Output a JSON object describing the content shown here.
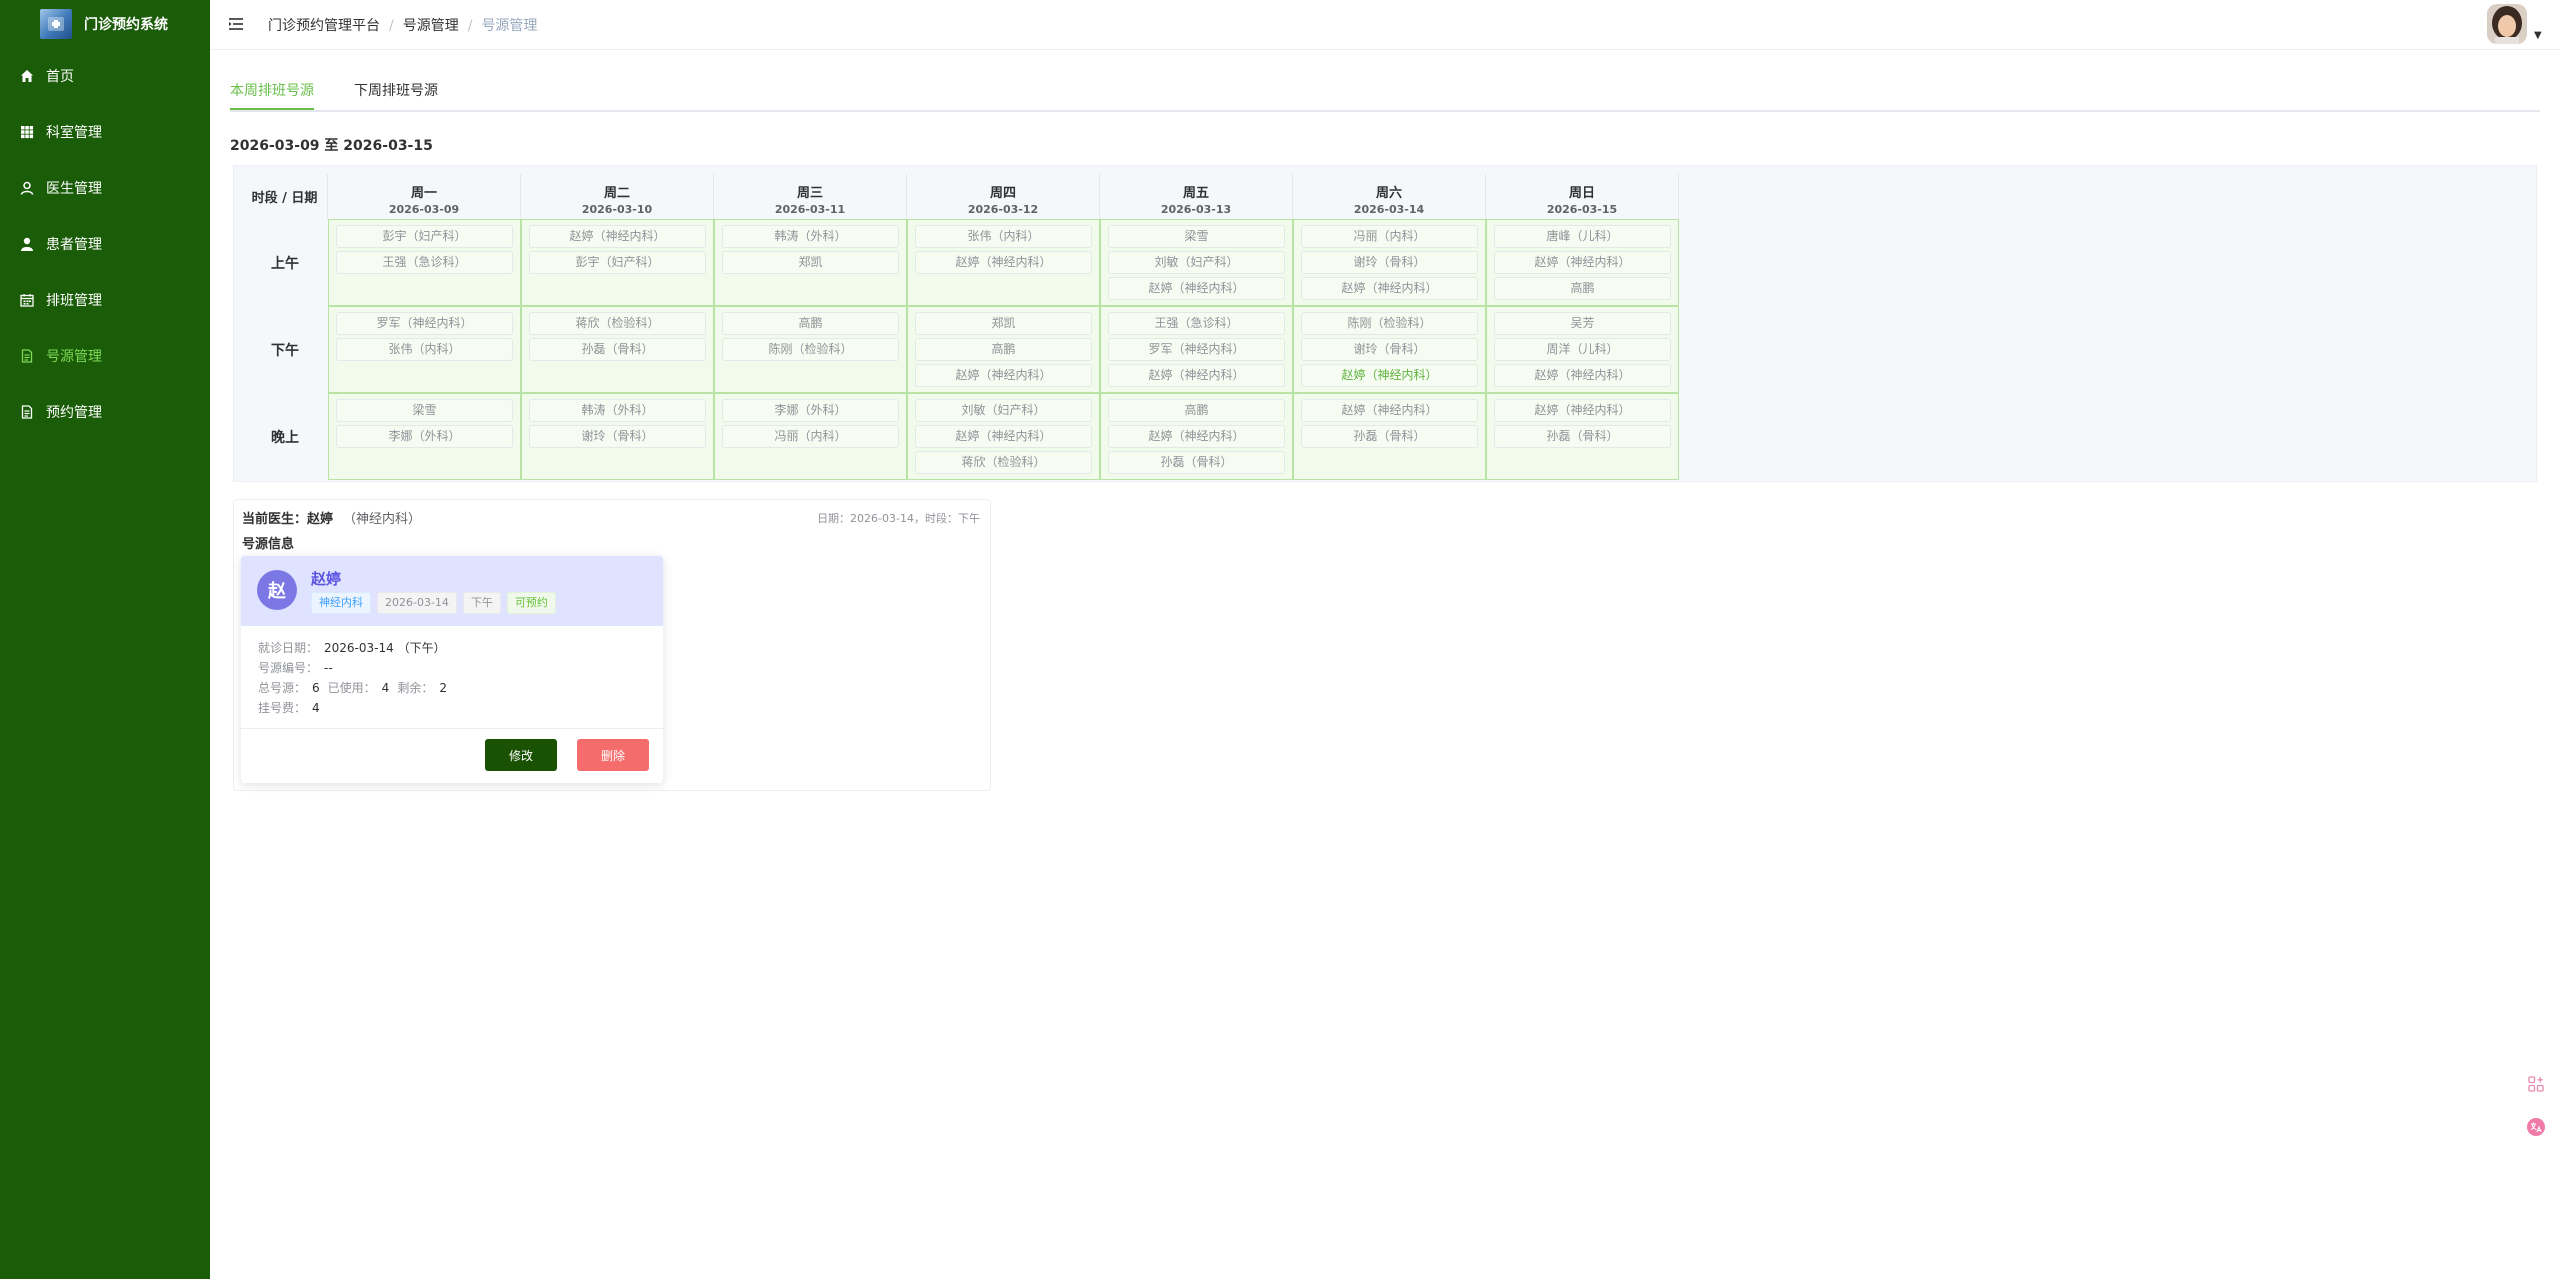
{
  "app": {
    "title": "门诊预约系统"
  },
  "sidebar": {
    "items": [
      {
        "label": "首页",
        "icon": "home-icon"
      },
      {
        "label": "科室管理",
        "icon": "grid-icon"
      },
      {
        "label": "医生管理",
        "icon": "user-outline-icon"
      },
      {
        "label": "患者管理",
        "icon": "user-solid-icon"
      },
      {
        "label": "排班管理",
        "icon": "calendar-icon"
      },
      {
        "label": "号源管理",
        "icon": "document-icon",
        "active": true
      },
      {
        "label": "预约管理",
        "icon": "document-icon"
      }
    ],
    "bg_color": "#1a5c08",
    "active_color": "#7ed957"
  },
  "header": {
    "breadcrumb": [
      "门诊预约管理平台",
      "号源管理",
      "号源管理"
    ]
  },
  "tabs": [
    {
      "label": "本周排班号源",
      "active": true
    },
    {
      "label": "下周排班号源",
      "active": false
    }
  ],
  "week_range": "2026-03-09 至 2026-03-15",
  "schedule": {
    "corner": "时段 / 日期",
    "days": [
      {
        "name": "周一",
        "date": "2026-03-09"
      },
      {
        "name": "周二",
        "date": "2026-03-10"
      },
      {
        "name": "周三",
        "date": "2026-03-11"
      },
      {
        "name": "周四",
        "date": "2026-03-12"
      },
      {
        "name": "周五",
        "date": "2026-03-13"
      },
      {
        "name": "周六",
        "date": "2026-03-14"
      },
      {
        "name": "周日",
        "date": "2026-03-15"
      }
    ],
    "periods": [
      {
        "label": "上午",
        "cells": [
          [
            "彭宇（妇产科）",
            "王强（急诊科）"
          ],
          [
            "赵婷（神经内科）",
            "彭宇（妇产科）"
          ],
          [
            "韩涛（外科）",
            "郑凯"
          ],
          [
            "张伟（内科）",
            "赵婷（神经内科）"
          ],
          [
            "梁雪",
            "刘敏（妇产科）",
            "赵婷（神经内科）"
          ],
          [
            "冯丽（内科）",
            "谢玲（骨科）",
            "赵婷（神经内科）"
          ],
          [
            "唐峰（儿科）",
            "赵婷（神经内科）",
            "高鹏"
          ]
        ]
      },
      {
        "label": "下午",
        "cells": [
          [
            "罗军（神经内科）",
            "张伟（内科）"
          ],
          [
            "蒋欣（检验科）",
            "孙磊（骨科）"
          ],
          [
            "高鹏",
            "陈刚（检验科）"
          ],
          [
            "郑凯",
            "高鹏",
            "赵婷（神经内科）"
          ],
          [
            "王强（急诊科）",
            "罗军（神经内科）",
            "赵婷（神经内科）"
          ],
          [
            "陈刚（检验科）",
            "谢玲（骨科）",
            "赵婷（神经内科）"
          ],
          [
            "吴芳",
            "周洋（儿科）",
            "赵婷（神经内科）"
          ]
        ]
      },
      {
        "label": "晚上",
        "cells": [
          [
            "梁雪",
            "李娜（外科）"
          ],
          [
            "韩涛（外科）",
            "谢玲（骨科）"
          ],
          [
            "李娜（外科）",
            "冯丽（内科）"
          ],
          [
            "刘敏（妇产科）",
            "赵婷（神经内科）",
            "蒋欣（检验科）"
          ],
          [
            "高鹏",
            "赵婷（神经内科）",
            "孙磊（骨科）"
          ],
          [
            "赵婷（神经内科）",
            "孙磊（骨科）"
          ],
          [
            "赵婷（神经内科）",
            "孙磊（骨科）"
          ]
        ]
      }
    ]
  },
  "panel": {
    "current_label": "当前医生：",
    "current_name": "赵婷",
    "current_dept": "（神经内科）",
    "meta": "日期：2026-03-14，时段：下午",
    "info_title": "号源信息",
    "card": {
      "avatar": "赵",
      "name": "赵婷",
      "tags": [
        "神经内科",
        "2026-03-14",
        "下午",
        "可预约"
      ],
      "date_label": "就诊日期：",
      "date_value": "2026-03-14 （下午）",
      "code_label": "号源编号：",
      "code_value": "--",
      "total_label": "总号源：",
      "total_value": "6",
      "used_label": "已使用：",
      "used_value": "4",
      "remain_label": "剩余：",
      "remain_value": "2",
      "fee_label": "挂号费：",
      "fee_value": "4",
      "edit_label": "修改",
      "delete_label": "删除"
    }
  },
  "colors": {
    "accent": "#6abf4b",
    "cell_bg": "#f1fbec",
    "cell_border": "#b7e3a5",
    "edit_button": "#1a5203",
    "delete_button": "#f56c6c"
  }
}
